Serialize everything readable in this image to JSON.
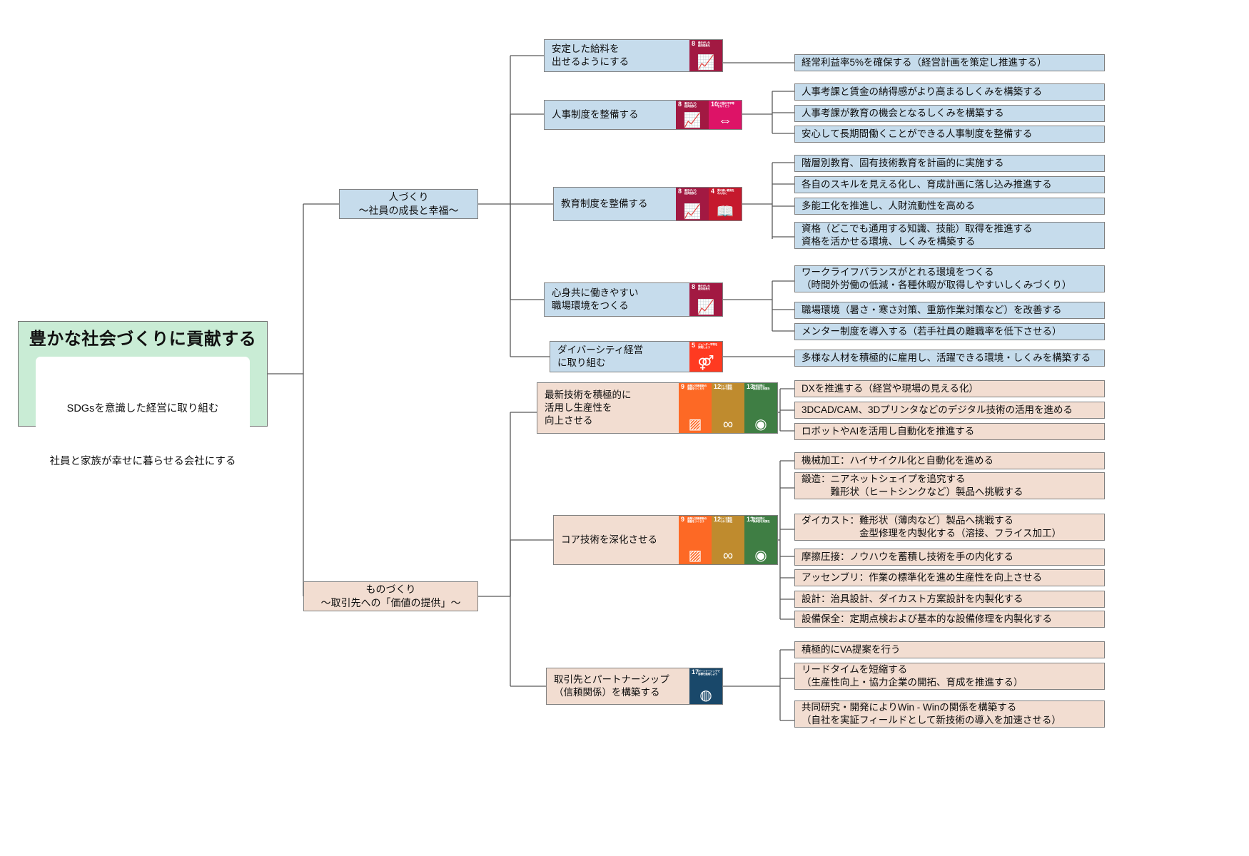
{
  "root": {
    "title": "豊かな社会づくりに貢献する",
    "sub_line1": "SDGsを意識した経営に取り組む",
    "sub_line2": "社員と家族が幸せに暮らせる会社にする"
  },
  "pillars": [
    {
      "id": "people",
      "line1": "人づくり",
      "line2": "〜社員の成長と幸福〜",
      "color": "#c6dcec"
    },
    {
      "id": "making",
      "line1": "ものづくり",
      "line2": "〜取引先への「価値の提供」〜",
      "color": "#f2ddd1"
    }
  ],
  "sdg_icons": {
    "8": {
      "num": "8",
      "caption": "働きがいも\n経済成長も",
      "color": "#a21942",
      "glyph": "📈"
    },
    "10": {
      "num": "10",
      "caption": "人や国の不平等\nをなくそう",
      "color": "#dd1367",
      "glyph": "⇔"
    },
    "4": {
      "num": "4",
      "caption": "質の高い教育を\nみんなに",
      "color": "#c5192d",
      "glyph": "📖"
    },
    "5": {
      "num": "5",
      "caption": "ジェンダー平等を\n実現しよう",
      "color": "#ff3a21",
      "glyph": "⚤"
    },
    "9": {
      "num": "9",
      "caption": "産業と技術革新の\n基盤をつくろう",
      "color": "#fd6925",
      "glyph": "▨"
    },
    "12": {
      "num": "12",
      "caption": "つくる責任\nつかう責任",
      "color": "#bf8b2e",
      "glyph": "∞"
    },
    "13": {
      "num": "13",
      "caption": "気候変動に\n具体的な対策を",
      "color": "#3f7e44",
      "glyph": "◉"
    },
    "17": {
      "num": "17",
      "caption": "パートナーシップで\n目標を達成しよう",
      "color": "#19486a",
      "glyph": "◍"
    }
  },
  "goals": [
    {
      "id": "salary",
      "label": "安定した給料を\n出せるようにする",
      "theme": "blue",
      "icons": [
        "8"
      ],
      "leaves": [
        {
          "text": "経常利益率5%を確保する（経営計画を策定し推進する）"
        }
      ]
    },
    {
      "id": "hr-system",
      "label": "人事制度を整備する",
      "theme": "blue",
      "icons": [
        "8",
        "10"
      ],
      "leaves": [
        {
          "text": "人事考課と賃金の納得感がより高まるしくみを構築する"
        },
        {
          "text": "人事考課が教育の機会となるしくみを構築する"
        },
        {
          "text": "安心して長期間働くことができる人事制度を整備する"
        }
      ]
    },
    {
      "id": "education-system",
      "label": "教育制度を整備する",
      "theme": "blue",
      "icons": [
        "8",
        "4"
      ],
      "leaves": [
        {
          "text": "階層別教育、固有技術教育を計画的に実施する"
        },
        {
          "text": "各自のスキルを見える化し、育成計画に落し込み推進する"
        },
        {
          "text": "多能工化を推進し、人財流動性を高める"
        },
        {
          "text": "資格（どこでも通用する知識、技能）取得を推進する\n資格を活かせる環境、しくみを構築する"
        }
      ]
    },
    {
      "id": "workplace",
      "label": "心身共に働きやすい\n職場環境をつくる",
      "theme": "blue",
      "icons": [
        "8"
      ],
      "leaves": [
        {
          "text": "ワークライフバランスがとれる環境をつくる\n（時間外労働の低減・各種休暇が取得しやすいしくみづくり）"
        },
        {
          "text": "職場環境（暑さ・寒さ対策、重筋作業対策など）を改善する"
        },
        {
          "text": "メンター制度を導入する（若手社員の離職率を低下させる）"
        }
      ]
    },
    {
      "id": "diversity",
      "label": "ダイバーシティ経営\nに取り組む",
      "theme": "blue",
      "icons": [
        "5"
      ],
      "leaves": [
        {
          "text": "多様な人材を積極的に雇用し、活躍できる環境・しくみを構築する"
        }
      ]
    },
    {
      "id": "latest-tech",
      "label": "最新技術を積極的に\n活用し生産性を\n向上させる",
      "theme": "peach",
      "icons": [
        "9",
        "12",
        "13"
      ],
      "leaves": [
        {
          "text": "DXを推進する（経営や現場の見える化）"
        },
        {
          "text": "3DCAD/CAM、3Dプリンタなどのデジタル技術の活用を進める"
        },
        {
          "text": "ロボットやAIを活用し自動化を推進する"
        }
      ]
    },
    {
      "id": "core-tech",
      "label": "コア技術を深化させる",
      "theme": "peach",
      "icons": [
        "9",
        "12",
        "13"
      ],
      "leaves": [
        {
          "text": "機械加工：ハイサイクル化と自動化を進める"
        },
        {
          "text": "鍛造：ニアネットシェイプを追究する\n　　　難形状（ヒートシンクなど）製品へ挑戦する"
        },
        {
          "text": "ダイカスト：難形状（薄肉など）製品へ挑戦する\n　　　　　　金型修理を内製化する（溶接、フライス加工）"
        },
        {
          "text": "摩擦圧接：ノウハウを蓄積し技術を手の内化する"
        },
        {
          "text": "アッセンブリ：作業の標準化を進め生産性を向上させる"
        },
        {
          "text": "設計：治具設計、ダイカスト方案設計を内製化する"
        },
        {
          "text": "設備保全：定期点検および基本的な設備修理を内製化する"
        }
      ]
    },
    {
      "id": "partnership",
      "label": "取引先とパートナーシップ\n（信頼関係）を構築する",
      "theme": "peach",
      "icons": [
        "17"
      ],
      "leaves": [
        {
          "text": "積極的にVA提案を行う"
        },
        {
          "text": "リードタイムを短縮する\n（生産性向上・協力企業の開拓、育成を推進する）"
        },
        {
          "text": "共同研究・開発によりWin - Winの関係を構築する\n（自社を実証フィールドとして新技術の導入を加速させる）"
        }
      ]
    }
  ],
  "palette": {
    "root_bg": "#c9ecd5",
    "people_bg": "#c6dcec",
    "making_bg": "#f2ddd1",
    "line": "#595959"
  }
}
